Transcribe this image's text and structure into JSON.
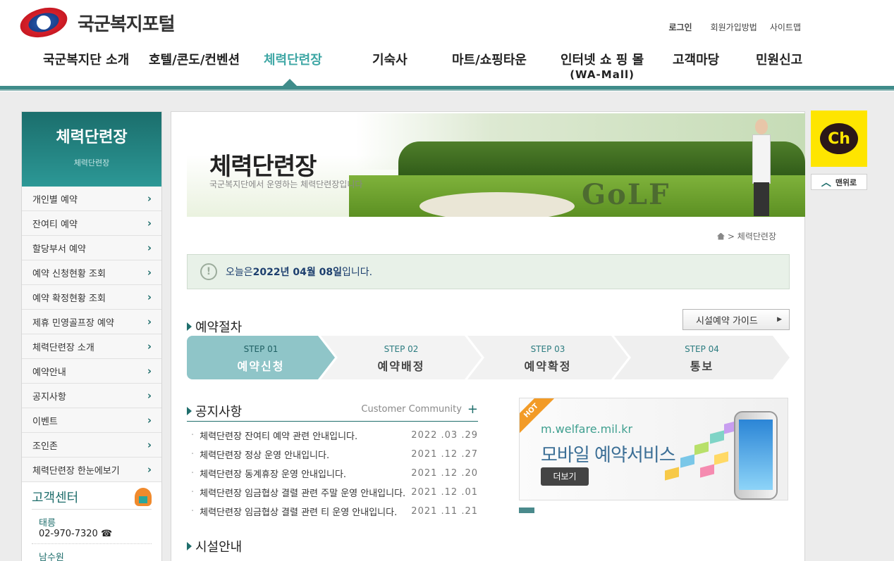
{
  "header": {
    "logo_text": "국군복지포털",
    "util": {
      "login": "로그인",
      "join": "회원가입방법",
      "sitemap": "사이트맵"
    },
    "gnb": [
      {
        "label": "국군복지단 소개",
        "sub": ""
      },
      {
        "label": "호텔/콘도/컨벤션",
        "sub": ""
      },
      {
        "label": "체력단련장",
        "sub": ""
      },
      {
        "label": "기숙사",
        "sub": ""
      },
      {
        "label": "마트/쇼핑타운",
        "sub": ""
      },
      {
        "label": "인터넷 쇼 핑 몰",
        "sub": "(WA-Mall)"
      },
      {
        "label": "고객마당",
        "sub": ""
      },
      {
        "label": "민원신고",
        "sub": ""
      }
    ]
  },
  "lnb": {
    "title": "체력단련장",
    "subtitle": "체력단련장",
    "items": [
      "개인별 예약",
      "잔여티 예약",
      "할당부서 예약",
      "예약 신청현황 조회",
      "예약 확정현황 조회",
      "제휴 민영골프장 예약",
      "체력단련장 소개",
      "예약안내",
      "공지사항",
      "이벤트",
      "조인존",
      "체력단련장 한눈에보기"
    ],
    "customer_center": {
      "title": "고객센터",
      "branches": [
        {
          "name": "태릉",
          "tel": "02-970-7320 ☎"
        },
        {
          "name": "남수원",
          "tel": ""
        }
      ]
    }
  },
  "banner": {
    "title": "체력단련장",
    "subtitle": "국군복지단에서 운영하는 체력단련장입니다",
    "golf_word": "GoLF"
  },
  "breadcrumb": {
    "current": "> 체력단련장"
  },
  "today": {
    "prefix": "오늘은 ",
    "date": "2022년 04월 08일",
    "suffix": "입니다."
  },
  "guide_button": "시설예약 가이드",
  "reservation": {
    "title": "예약절차",
    "steps": [
      {
        "num": "STEP 01",
        "name": "예약신청"
      },
      {
        "num": "STEP 02",
        "name": "예약배정"
      },
      {
        "num": "STEP 03",
        "name": "예약확정"
      },
      {
        "num": "STEP 04",
        "name": "통보"
      }
    ]
  },
  "notice": {
    "title": "공지사항",
    "more": "Customer Community",
    "items": [
      {
        "title": "체력단련장 잔여티 예약 관련 안내입니다.",
        "date": "2022 .03 .29"
      },
      {
        "title": "체력단련장 정상 운영 안내입니다.",
        "date": "2021 .12 .27"
      },
      {
        "title": "체력단련장 동계휴장 운영 안내입니다.",
        "date": "2021 .12 .20"
      },
      {
        "title": "체력단련장 임금협상 결렬 관련 주말 운영 안내입니다.",
        "date": "2021 .12 .01"
      },
      {
        "title": "체력단련장 임금협상 결렬 관련 티 운영 안내입니다.",
        "date": "2021 .11 .21"
      }
    ]
  },
  "mobile_banner": {
    "badge": "HOT",
    "url": "m.welfare.mil.kr",
    "title": "모바일 예약서비스",
    "more": "더보기"
  },
  "facility": {
    "title": "시설안내"
  },
  "side": {
    "kakao": "Ch",
    "top": "맨위로"
  },
  "colors": {
    "brand": "#3f8c8a",
    "active_menu": "#3fa7a5",
    "kakao": "#fee500"
  }
}
